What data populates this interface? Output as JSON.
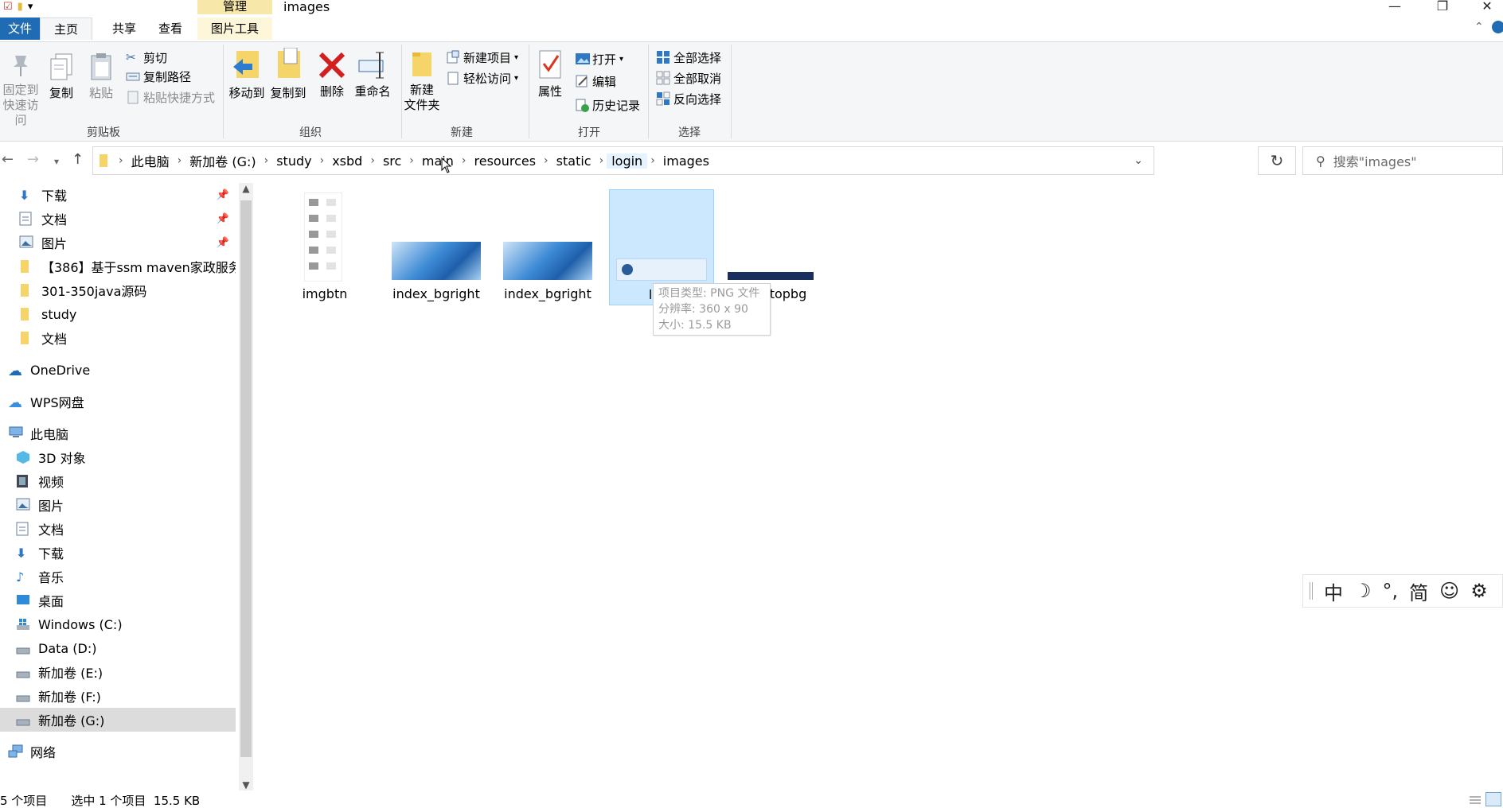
{
  "window": {
    "title": "images",
    "contextual_tab_header": "管理",
    "controls": {
      "minimize": "—",
      "restore": "❐",
      "close": "✕"
    }
  },
  "ribbon_tabs": {
    "file": "文件",
    "home": "主页",
    "share": "共享",
    "view": "查看",
    "picture_tools": "图片工具"
  },
  "ribbon": {
    "clipboard": {
      "label": "剪贴板",
      "pin_quick_access": [
        "固定到",
        "快速访问"
      ],
      "copy": "复制",
      "paste": "粘贴",
      "cut": "剪切",
      "copy_path": "复制路径",
      "paste_shortcut": "粘贴快捷方式"
    },
    "organize": {
      "label": "组织",
      "move_to": "移动到",
      "copy_to": "复制到",
      "delete": "删除",
      "rename": "重命名"
    },
    "new": {
      "label": "新建",
      "new_folder": [
        "新建",
        "文件夹"
      ],
      "new_item": "新建项目",
      "easy_access": "轻松访问"
    },
    "open": {
      "label": "打开",
      "properties": "属性",
      "open": "打开",
      "edit": "编辑",
      "history": "历史记录"
    },
    "select": {
      "label": "选择",
      "select_all": "全部选择",
      "select_none": "全部取消",
      "invert": "反向选择"
    }
  },
  "address": {
    "crumbs": [
      "此电脑",
      "新加卷 (G:)",
      "study",
      "xsbd",
      "src",
      "main",
      "resources",
      "static",
      "login",
      "images"
    ],
    "search_placeholder": "搜索\"images\""
  },
  "nav": {
    "quick_access": [
      {
        "label": "下载",
        "pinned": true
      },
      {
        "label": "文档",
        "pinned": true
      },
      {
        "label": "图片",
        "pinned": true
      },
      {
        "label": "【386】基于ssm maven家政服务预约",
        "pinned": false
      },
      {
        "label": "301-350java源码",
        "pinned": false
      },
      {
        "label": "study",
        "pinned": false
      },
      {
        "label": "文档",
        "pinned": false
      }
    ],
    "onedrive": "OneDrive",
    "wps": "WPS网盘",
    "this_pc": "此电脑",
    "pc_items": [
      "3D 对象",
      "视频",
      "图片",
      "文档",
      "下载",
      "音乐",
      "桌面",
      "Windows (C:)",
      "Data (D:)",
      "新加卷 (E:)",
      "新加卷 (F:)",
      "新加卷 (G:)"
    ],
    "network": "网络"
  },
  "files": [
    {
      "name": "imgbtn",
      "selected": false
    },
    {
      "name": "index_bgright",
      "selected": false
    },
    {
      "name": "index_bgright",
      "selected": false
    },
    {
      "name": "logo",
      "selected": true
    },
    {
      "name": "pagetopbg",
      "selected": false
    }
  ],
  "tooltip": {
    "type": "项目类型: PNG 文件",
    "resolution": "分辨率: 360 x 90",
    "size": "大小: 15.5 KB"
  },
  "ime": {
    "items": [
      "中",
      "☽",
      "°,",
      "简",
      "☺",
      "⚙"
    ]
  },
  "status": {
    "count": "5 个项目",
    "selection": "选中 1 个项目  15.5 KB"
  },
  "colors": {
    "accent": "#1f6cb5",
    "selection": "#cce8ff",
    "manage_tab": "#f7e7a8"
  }
}
